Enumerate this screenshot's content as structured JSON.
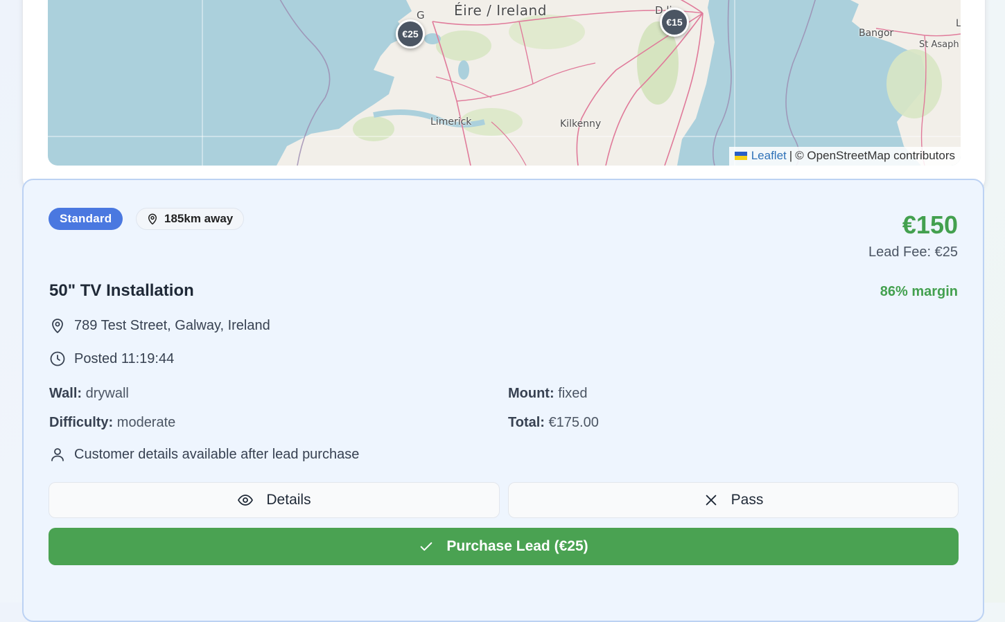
{
  "map": {
    "labels": {
      "country": "Éire / Ireland",
      "limerick": "Limerick",
      "kilkenny": "Kilkenny",
      "bangor": "Bangor",
      "st_asaph": "St Asaph",
      "dublin_partial": "D   lin",
      "galway_partial": "G",
      "edge_partial": "L"
    },
    "markers": [
      {
        "label": "€25"
      },
      {
        "label": "€15"
      }
    ],
    "attribution": {
      "leaflet": "Leaflet",
      "separator": "|",
      "osm": "© OpenStreetMap contributors"
    },
    "colors": {
      "water": "#abd0dc",
      "land": "#f2efe9",
      "road": "#e07a9a",
      "marker": "#4b5563"
    }
  },
  "lead": {
    "tier_badge": "Standard",
    "distance": "185km away",
    "price": "€150",
    "lead_fee": "Lead Fee: €25",
    "title": "50\" TV Installation",
    "margin": "86% margin",
    "address": "789 Test Street, Galway, Ireland",
    "posted": "Posted 11:19:44",
    "specs": {
      "wall_key": "Wall:",
      "wall_val": "drywall",
      "mount_key": "Mount:",
      "mount_val": "fixed",
      "difficulty_key": "Difficulty:",
      "difficulty_val": "moderate",
      "total_key": "Total:",
      "total_val": "€175.00"
    },
    "customer_note": "Customer details available after lead purchase",
    "buttons": {
      "details": "Details",
      "pass": "Pass",
      "purchase": "Purchase Lead (€25)"
    },
    "colors": {
      "accent_green": "#43a04f",
      "badge_blue": "#4a78e0",
      "button_green": "#4aa252"
    },
    "icons": {
      "distance": "map-pin-icon",
      "address": "map-pin-icon",
      "posted": "clock-icon",
      "customer": "user-icon",
      "details": "eye-icon",
      "pass": "x-icon",
      "purchase": "check-icon"
    }
  }
}
